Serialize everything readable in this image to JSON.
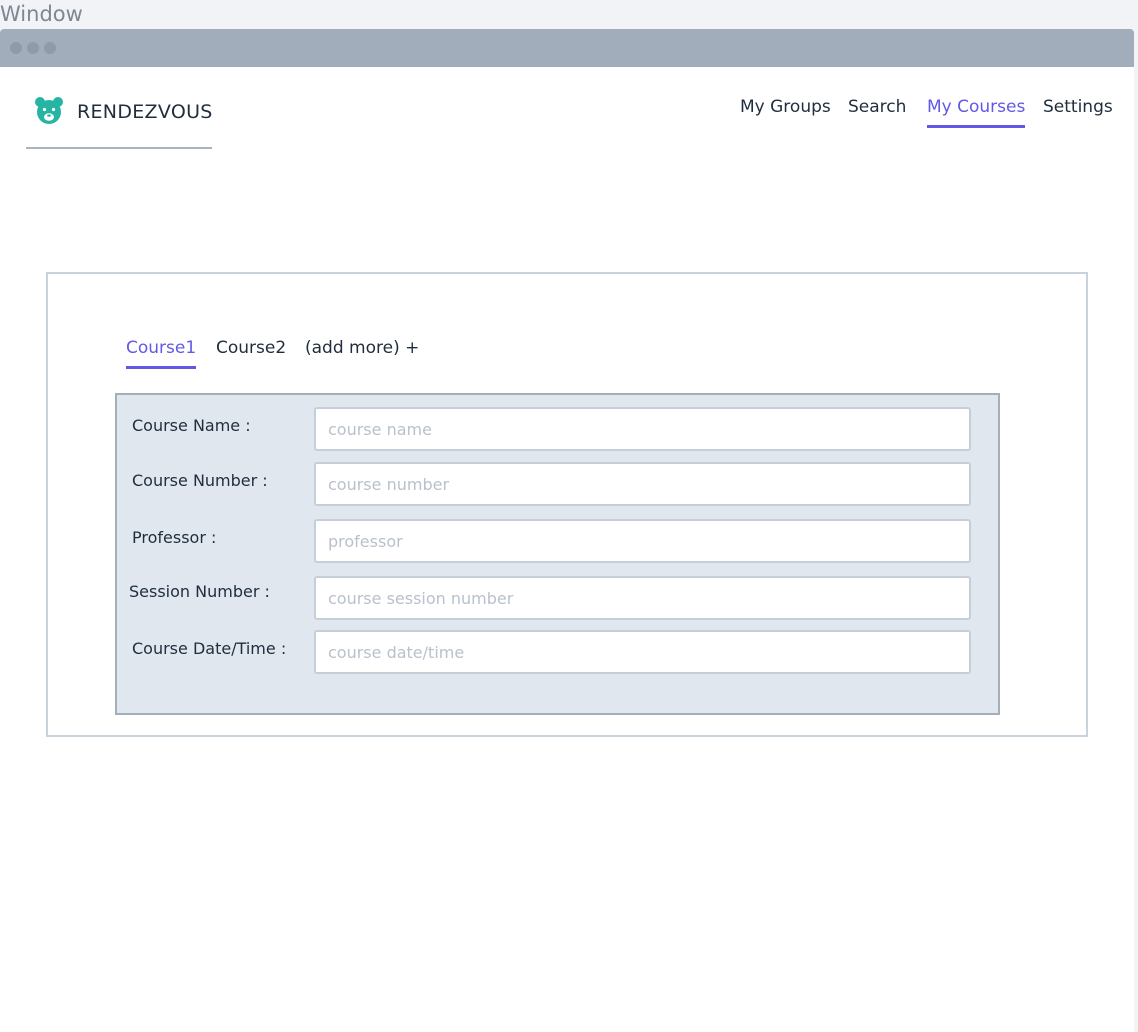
{
  "window": {
    "label": "Window"
  },
  "brand": {
    "name": "RENDEZVOUS",
    "icon": "bear-icon",
    "icon_color": "#26b5a3"
  },
  "nav": {
    "items": [
      {
        "label": "My Groups",
        "active": false
      },
      {
        "label": "Search",
        "active": false
      },
      {
        "label": "My Courses",
        "active": true
      },
      {
        "label": "Settings",
        "active": false
      }
    ]
  },
  "courses": {
    "tabs": [
      {
        "label": "Course1",
        "active": true
      },
      {
        "label": "Course2",
        "active": false
      },
      {
        "label": "(add more) +",
        "active": false
      }
    ],
    "form": {
      "fields": [
        {
          "label": "Course Name :",
          "placeholder": "course name",
          "value": ""
        },
        {
          "label": "Course Number :",
          "placeholder": "course number",
          "value": ""
        },
        {
          "label": "Professor :",
          "placeholder": "professor",
          "value": ""
        },
        {
          "label": "Session Number :",
          "placeholder": "course session number",
          "value": ""
        },
        {
          "label": "Course Date/Time :",
          "placeholder": "course date/time",
          "value": ""
        }
      ]
    }
  },
  "colors": {
    "accent": "#6159e6",
    "titlebar": "#a1adba",
    "form_background": "#e1e7ef"
  }
}
